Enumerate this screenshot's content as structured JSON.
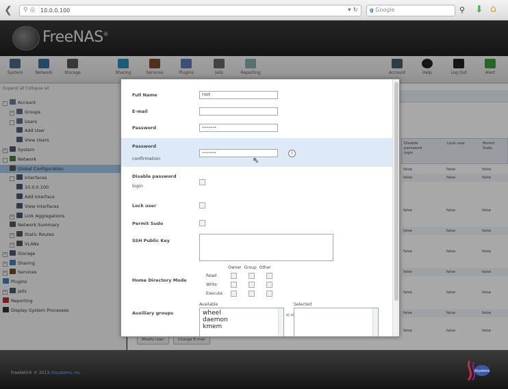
{
  "browser": {
    "url": "10.0.0.100",
    "search_placeholder": "Google"
  },
  "app": {
    "logo_text": "FreeNAS",
    "logo_mark": "®"
  },
  "toolbar_left": [
    {
      "label": "System",
      "icon": "system-icon"
    },
    {
      "label": "Network",
      "icon": "network-icon"
    },
    {
      "label": "Storage",
      "icon": "storage-icon"
    },
    {
      "label": "Sharing",
      "icon": "sharing-icon"
    },
    {
      "label": "Services",
      "icon": "services-icon"
    },
    {
      "label": "Plugins",
      "icon": "plugins-icon"
    },
    {
      "label": "Jails",
      "icon": "jails-icon"
    },
    {
      "label": "Reporting",
      "icon": "reporting-icon"
    }
  ],
  "toolbar_right": [
    {
      "label": "Account",
      "icon": "account-icon"
    },
    {
      "label": "Help",
      "icon": "help-icon"
    },
    {
      "label": "Log Out",
      "icon": "logout-icon"
    },
    {
      "label": "Alert",
      "icon": "alert-icon"
    }
  ],
  "tree": {
    "expand_collapse": "Expand all  Collapse all",
    "items": [
      {
        "label": "Account",
        "level": 0,
        "pm": "-",
        "color": "#6a7f9e"
      },
      {
        "label": "Groups",
        "level": 1,
        "pm": "+",
        "color": "#5d6e88"
      },
      {
        "label": "Users",
        "level": 1,
        "pm": "-",
        "color": "#5d6e88"
      },
      {
        "label": "Add User",
        "level": 2,
        "pm": "",
        "color": "#4f5f78"
      },
      {
        "label": "View Users",
        "level": 2,
        "pm": "",
        "color": "#4f5f78"
      },
      {
        "label": "System",
        "level": 0,
        "pm": "+",
        "color": "#4a5a70"
      },
      {
        "label": "Network",
        "level": 0,
        "pm": "-",
        "color": "#4a7a4a"
      },
      {
        "label": "Global Configuration",
        "level": 1,
        "pm": "",
        "color": "#555",
        "selected": true
      },
      {
        "label": "Interfaces",
        "level": 1,
        "pm": "-",
        "color": "#4a5a70"
      },
      {
        "label": "10.0.0.100",
        "level": 2,
        "pm": "",
        "color": "#4a5a70"
      },
      {
        "label": "Add Interface",
        "level": 2,
        "pm": "",
        "color": "#4a5a70"
      },
      {
        "label": "View Interfaces",
        "level": 2,
        "pm": "",
        "color": "#4a5a70"
      },
      {
        "label": "Link Aggregations",
        "level": 1,
        "pm": "+",
        "color": "#4a5a70"
      },
      {
        "label": "Network Summary",
        "level": 1,
        "pm": "",
        "color": "#555"
      },
      {
        "label": "Static Routes",
        "level": 1,
        "pm": "+",
        "color": "#555"
      },
      {
        "label": "VLANs",
        "level": 1,
        "pm": "+",
        "color": "#555"
      },
      {
        "label": "Storage",
        "level": 0,
        "pm": "+",
        "color": "#4a5a70"
      },
      {
        "label": "Sharing",
        "level": 0,
        "pm": "+",
        "color": "#3f7fb8"
      },
      {
        "label": "Services",
        "level": 0,
        "pm": "+",
        "color": "#6a4a2a"
      },
      {
        "label": "Plugins",
        "level": 0,
        "pm": "",
        "color": "#3f7fb8"
      },
      {
        "label": "Jails",
        "level": 0,
        "pm": "+",
        "color": "#4a5a70"
      },
      {
        "label": "Reporting",
        "level": 0,
        "pm": "",
        "color": "#b03030"
      },
      {
        "label": "Display System Processes",
        "level": 0,
        "pm": "",
        "color": "#333"
      }
    ]
  },
  "grid": {
    "headers": [
      "Disable password login",
      "Lock user",
      "Permit Sudo"
    ],
    "rows": [
      [
        "false",
        "false",
        "false"
      ],
      [
        "false",
        "false",
        "false"
      ],
      [
        "false",
        "false",
        "false"
      ],
      [
        "false",
        "false",
        "false"
      ],
      [
        "false",
        "false",
        "false"
      ],
      [
        "false",
        "false",
        "false"
      ],
      [
        "false",
        "false",
        "false"
      ],
      [
        "false",
        "false",
        "false"
      ],
      [
        "false",
        "false",
        "false"
      ]
    ],
    "buttons": [
      "Modify User",
      "Change E-mail"
    ]
  },
  "modal": {
    "full_name_label": "Full Name",
    "full_name_value": "root",
    "email_label": "E-mail",
    "email_value": "",
    "password_label": "Password",
    "password_value": "•••••••",
    "password_conf_label_1": "Password",
    "password_conf_label_2": "confirmation",
    "password_conf_value": "•••••••",
    "help_glyph": "i",
    "disable_pw_label_1": "Disable password",
    "disable_pw_label_2": "login",
    "lock_user_label": "Lock user",
    "permit_sudo_label": "Permit Sudo",
    "ssh_key_label": "SSH Public Key",
    "home_mode_label": "Home Directory Mode",
    "perm_cols": [
      "Owner",
      "Group",
      "Other"
    ],
    "perm_rows": [
      "Read",
      "Write",
      "Execute"
    ],
    "aux_groups_label": "Auxiliary groups",
    "aux_available_label": "Available",
    "aux_selected_label": "Selected",
    "aux_available_items": [
      "wheel",
      "daemon",
      "kmem"
    ],
    "aux_move": "<<"
  },
  "footer": {
    "text_prefix": "FreeNAS® © 2013",
    "text_link": "iXsystems, Inc.",
    "brand": "iXsystems"
  }
}
